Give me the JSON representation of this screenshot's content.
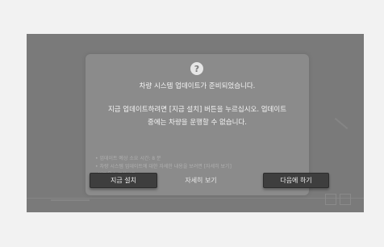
{
  "dialog": {
    "icon": "question-mark-icon",
    "icon_glyph": "?",
    "title": "차량 시스템 업데이트가 준비되었습니다.",
    "message_line1": "지금 업데이트하려면 [지금 설치] 버튼을 누르십시오. 업데이트",
    "message_line2": "중에는 차량을 운행할 수 없습니다.",
    "note1": "• 업데이트 예상 소요 시간: 8 분",
    "note2": "• 차량 시스템 업데이트에 대한 자세한 내용을 보려면 [자세히 보기]",
    "note3": "  버튼을 누르십시오.",
    "buttons": {
      "install": "지금 설치",
      "details": "자세히 보기",
      "later": "다음에 하기"
    }
  },
  "colors": {
    "outer_background": "#f2f2f2",
    "screen_dim": "#7a7a7a",
    "dialog_background": "#8b8b8b",
    "button_dark": "#3e3e3e"
  }
}
